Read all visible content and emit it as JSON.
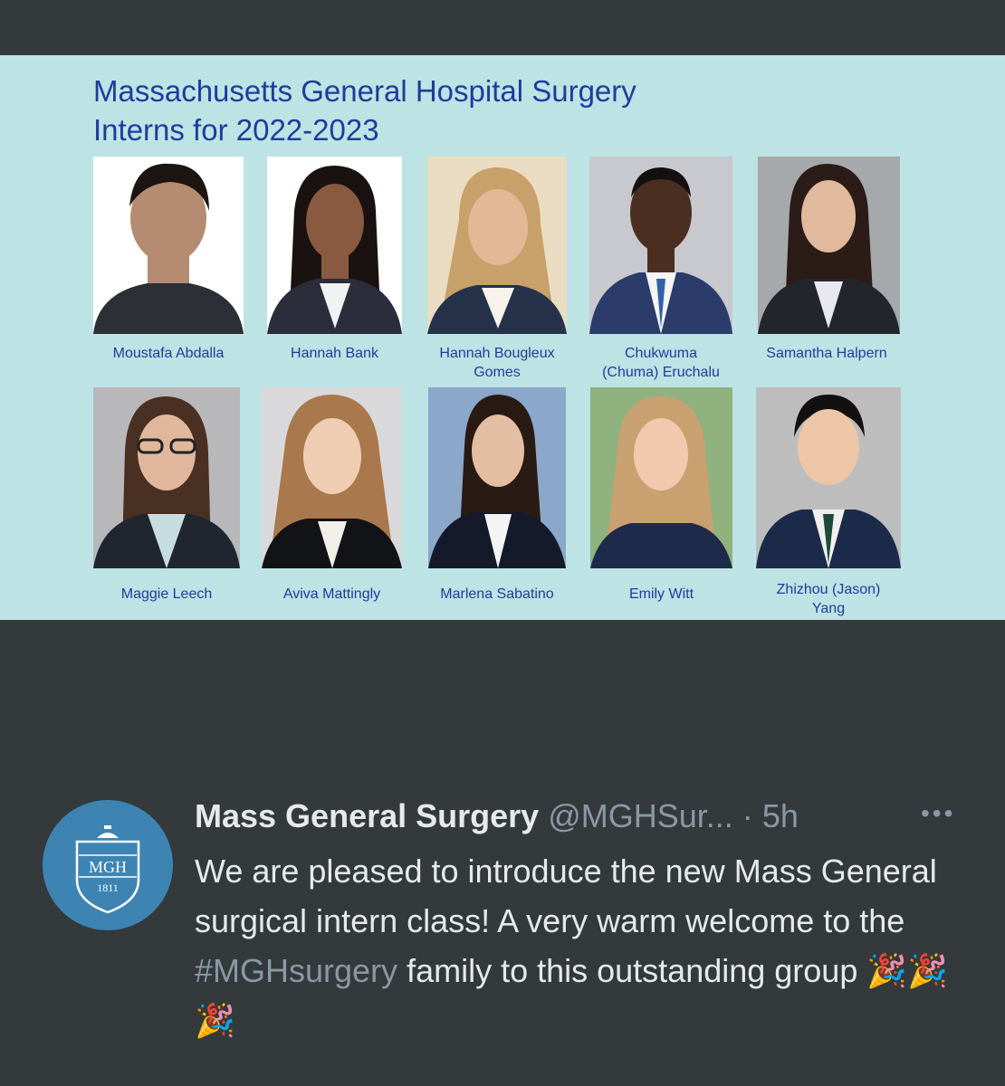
{
  "slide": {
    "title_line1": "Massachusetts General Hospital Surgery",
    "title_line2": "Interns for 2022-2023",
    "interns": [
      {
        "name_line1": "Moustafa Abdalla",
        "name_line2": ""
      },
      {
        "name_line1": "Hannah Bank",
        "name_line2": ""
      },
      {
        "name_line1": "Hannah Bougleux",
        "name_line2": "Gomes"
      },
      {
        "name_line1": "Chukwuma",
        "name_line2": "(Chuma) Eruchalu"
      },
      {
        "name_line1": "Samantha Halpern",
        "name_line2": ""
      },
      {
        "name_line1": "Maggie Leech",
        "name_line2": ""
      },
      {
        "name_line1": "Aviva Mattingly",
        "name_line2": ""
      },
      {
        "name_line1": "Marlena Sabatino",
        "name_line2": ""
      },
      {
        "name_line1": "Emily Witt",
        "name_line2": ""
      },
      {
        "name_line1": "Zhizhou (Jason)",
        "name_line2": "Yang"
      }
    ]
  },
  "tweet": {
    "avatar_text": "MGH",
    "avatar_year": "1811",
    "display_name": "Mass General Surgery",
    "handle": "@MGHSur...",
    "separator": "·",
    "time": "5h",
    "more_icon": "•••",
    "text_before": "We are pleased to introduce the new Mass General surgical intern class! A very warm welcome to the ",
    "hashtag": "#MGHsurgery",
    "text_after": " family to this outstanding group ",
    "emojis": "🎉🎉🎉"
  },
  "colors": {
    "background": "#343a3c",
    "slide_background": "#bde3e4",
    "slide_text": "#1f3c9c",
    "avatar_background": "#3d84b3"
  }
}
